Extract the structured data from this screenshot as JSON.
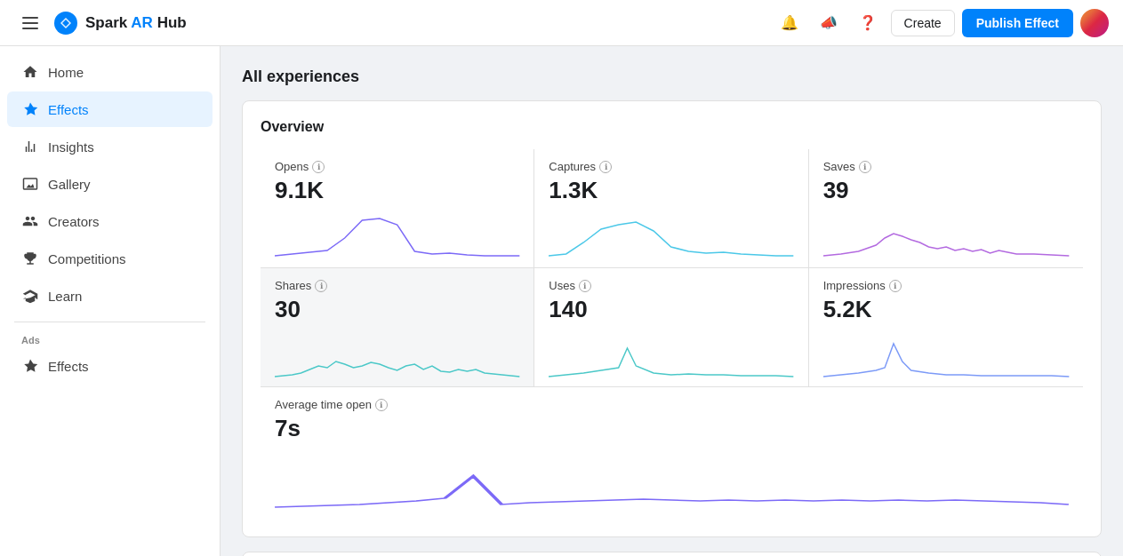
{
  "topbar": {
    "app_name": "Spark AR Hub",
    "app_name_brand": "AR",
    "create_label": "Create",
    "publish_label": "Publish Effect"
  },
  "sidebar": {
    "items": [
      {
        "id": "home",
        "label": "Home",
        "icon": "🏠"
      },
      {
        "id": "effects",
        "label": "Effects",
        "icon": "✦",
        "active": true
      },
      {
        "id": "insights",
        "label": "Insights",
        "icon": "📊"
      },
      {
        "id": "gallery",
        "label": "Gallery",
        "icon": "🖼"
      },
      {
        "id": "creators",
        "label": "Creators",
        "icon": "👥"
      },
      {
        "id": "competitions",
        "label": "Competitions",
        "icon": "🏆"
      },
      {
        "id": "learn",
        "label": "Learn",
        "icon": "📖"
      }
    ],
    "ads_label": "Ads",
    "ads_items": [
      {
        "id": "ads-effects",
        "label": "Effects",
        "icon": "✦"
      }
    ]
  },
  "main": {
    "section_title": "All experiences",
    "overview_title": "Overview",
    "metrics": [
      {
        "label": "Opens",
        "value": "9.1K",
        "color": "#7c6af7",
        "row": 0,
        "col": 0
      },
      {
        "label": "Captures",
        "value": "1.3K",
        "color": "#4bc8e8",
        "row": 0,
        "col": 1
      },
      {
        "label": "Saves",
        "value": "39",
        "color": "#b36ae0",
        "row": 0,
        "col": 2
      },
      {
        "label": "Shares",
        "value": "30",
        "color": "#4bc8c8",
        "highlighted": true,
        "row": 1,
        "col": 0
      },
      {
        "label": "Uses",
        "value": "140",
        "color": "#4bc8c8",
        "row": 1,
        "col": 1
      },
      {
        "label": "Impressions",
        "value": "5.2K",
        "color": "#7c9af7",
        "row": 1,
        "col": 2
      }
    ],
    "avg_time": {
      "label": "Average time open",
      "value": "7s",
      "color": "#7c6af7"
    }
  }
}
